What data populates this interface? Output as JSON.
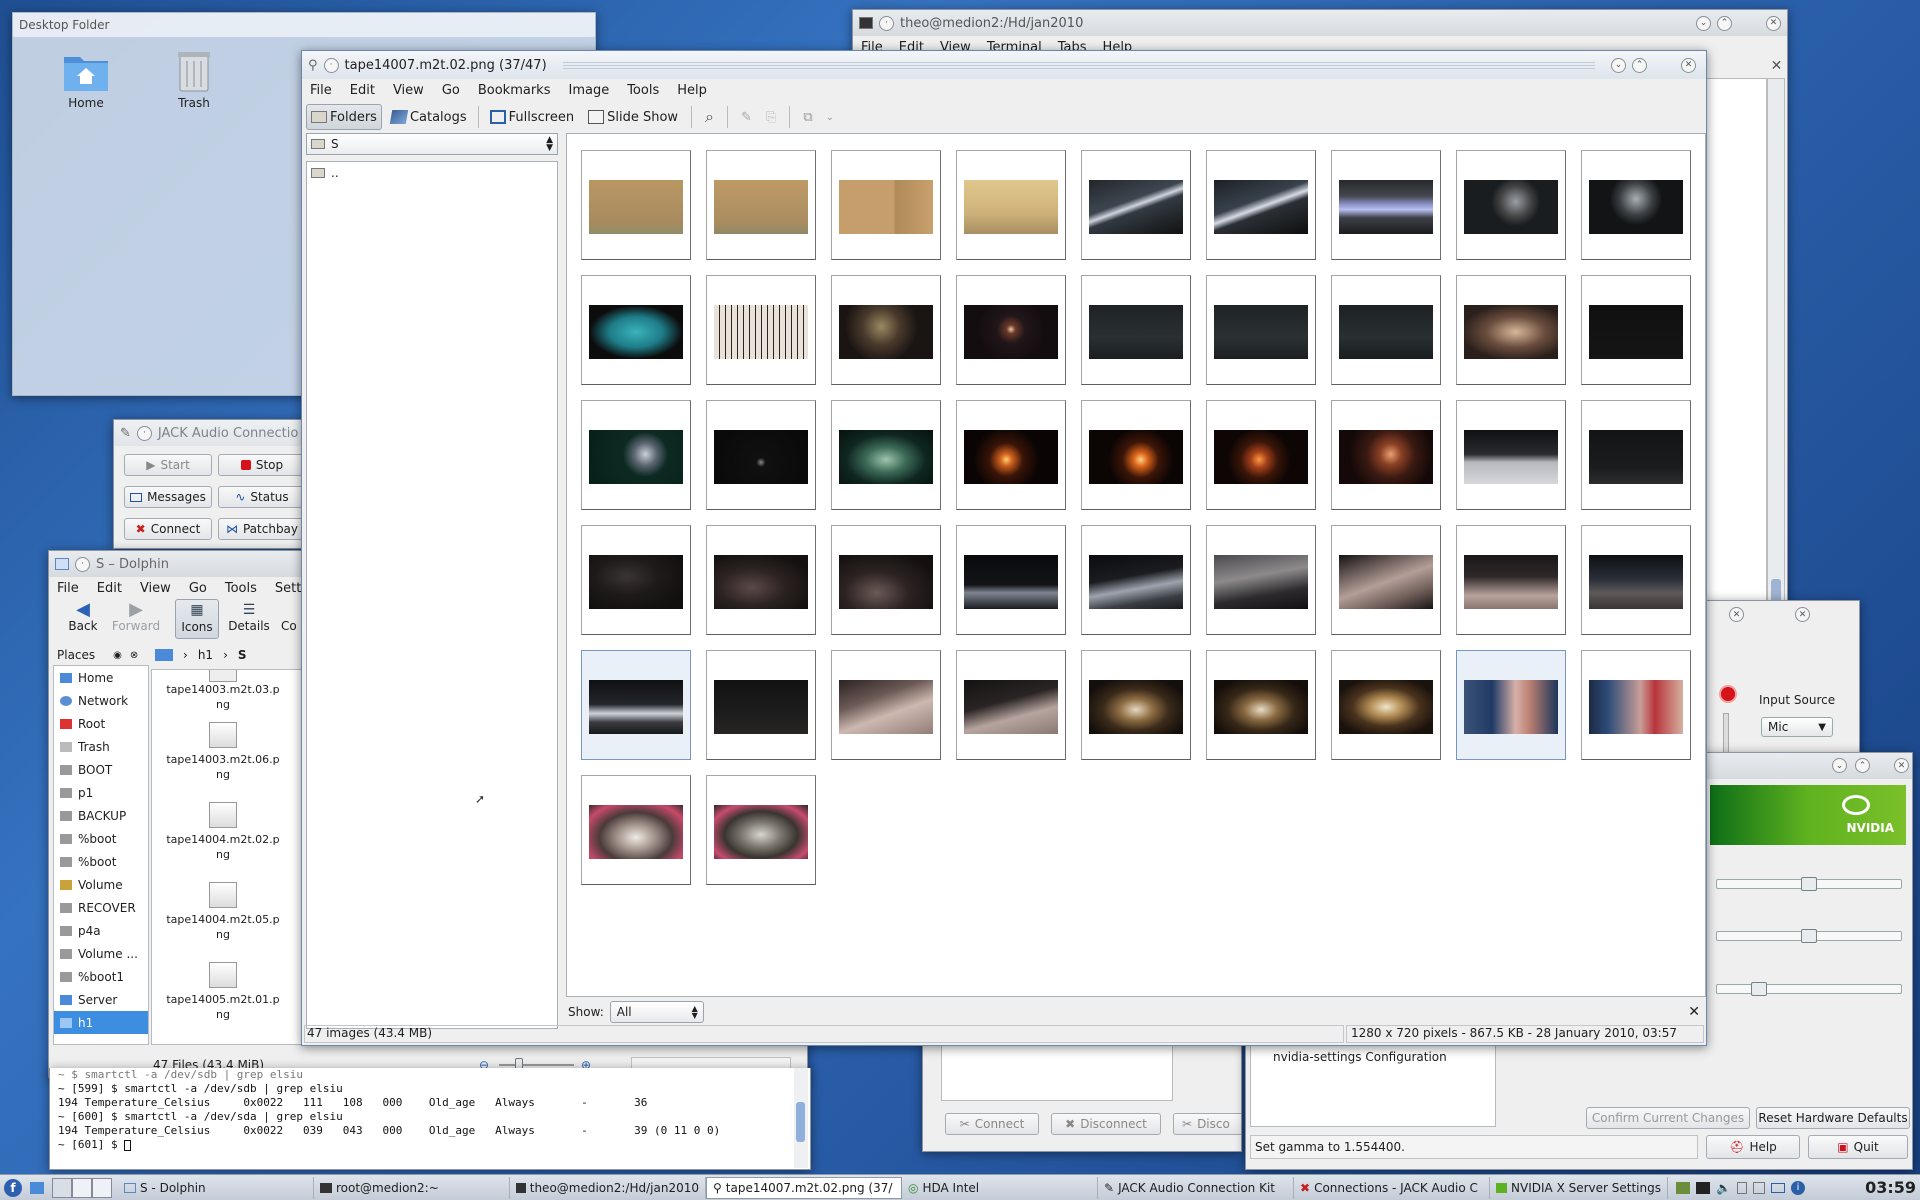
{
  "desktop_folder": {
    "title": "Desktop Folder",
    "icons": [
      {
        "label": "Home"
      },
      {
        "label": "Trash"
      }
    ]
  },
  "terminal_win": {
    "title": "theo@medion2:/Hd/jan2010",
    "menu": [
      "File",
      "Edit",
      "View",
      "Terminal",
      "Tabs",
      "Help"
    ]
  },
  "jack": {
    "title": "JACK Audio Connectio",
    "buttons": {
      "start": "Start",
      "stop": "Stop",
      "messages": "Messages",
      "status": "Status",
      "connect": "Connect",
      "patchbay": "Patchbay"
    }
  },
  "dolphin": {
    "title": "S – Dolphin",
    "menu": [
      "File",
      "Edit",
      "View",
      "Go",
      "Tools",
      "Setting"
    ],
    "toolbar": {
      "back": "Back",
      "forward": "Forward",
      "icons": "Icons",
      "details": "Details",
      "co": "Co"
    },
    "places_title": "Places",
    "places": [
      "Home",
      "Network",
      "Root",
      "Trash",
      "BOOT",
      "p1",
      "BACKUP",
      "%boot",
      "%boot",
      "Volume",
      "RECOVER",
      "p4a",
      "Volume ...",
      "%boot1",
      "Server",
      "h1"
    ],
    "breadcrumb": [
      "h1",
      "S"
    ],
    "files": [
      "tape14003.m2t.03.p\nng",
      "tape14003.m2t.06.p\nng",
      "tape14004.m2t.02.p\nng",
      "tape14004.m2t.05.p\nng",
      "tape14005.m2t.01.p\nng"
    ],
    "status": "47 Files (43.4 MiB)"
  },
  "root_terminal": {
    "lines": [
      "~ $ smartctl -a /dev/sdb | grep elsiu",
      "~ [599] $ smartctl -a /dev/sdb | grep elsiu",
      "194 Temperature_Celsius     0x0022   111   108   000    Old_age   Always       -       36",
      "~ [600] $ smartctl -a /dev/sda | grep elsiu",
      "194 Temperature_Celsius     0x0022   039   043   000    Old_age   Always       -       39 (0 11 0 0)",
      "~ [601] $ "
    ]
  },
  "jack_connections": {
    "buttons": {
      "connect": "Connect",
      "disconnect": "Disconnect",
      "disco": "Disco"
    }
  },
  "hda_mixer": {
    "input_source_label": "Input Source",
    "input_source_value": "Mic"
  },
  "nvidia": {
    "logo": "NVIDIA",
    "config_item": "nvidia-settings Configuration",
    "confirm_btn": "Confirm Current Changes",
    "reset_btn": "Reset Hardware Defaults",
    "status": "Set gamma to 1.554400.",
    "help_btn": "Help",
    "quit_btn": "Quit",
    "slider_values": [
      0.5,
      0.5,
      0.2
    ]
  },
  "gthumb": {
    "title": "tape14007.m2t.02.png  (37/47)",
    "menu": [
      "File",
      "Edit",
      "View",
      "Go",
      "Bookmarks",
      "Image",
      "Tools",
      "Help"
    ],
    "toolbar": {
      "folders": "Folders",
      "catalogs": "Catalogs",
      "fullscreen": "Fullscreen",
      "slideshow": "Slide Show"
    },
    "location": "S",
    "tree_item": "..",
    "show_label": "Show:",
    "show_value": "All",
    "status_left": "47 images (43.4 MB)",
    "status_right": "1280 x 720 pixels - 867.5 KB - 28 January 2010, 03:57",
    "thumbs": [
      {
        "c": "linear-gradient(#b99763,#a78b5f 80%,#8f8d6a)"
      },
      {
        "c": "linear-gradient(#bf9a66,#a98c60 80%,#8d8a68)"
      },
      {
        "c": "linear-gradient(90deg,#c59e6b 0,#c59e6b 58%,#b08a58 60%,#c8a06c 100%)"
      },
      {
        "c": "linear-gradient(#e0c78e,#cfb27a 60%,#a88f63)"
      },
      {
        "c": "linear-gradient(160deg,#23272b 0,#3d4650 40%,#cfd4df 48%,#323a42 55%,#111 100%)"
      },
      {
        "c": "linear-gradient(160deg,#1c2024 0,#38424c 40%,#d7dbe6 50%,#2b3036 58%,#0e0e0e 100%)"
      },
      {
        "c": "linear-gradient(#26282c,#44484e 30%,#8b92c8 45%,#b8bff0 55%,#3d4046 70%,#1b1c1f)"
      },
      {
        "c": "radial-gradient(circle at 55% 40%,#9aa0a8 0,#444 25%,#1a1d20 40%),linear-gradient(90deg,#2db36d,#b23bb2,#0c0c0c)"
      },
      {
        "c": "radial-gradient(circle at 50% 35%,#aab0b6 0,#3a3e42 28%,#121416 45%)"
      },
      {
        "c": "radial-gradient(ellipse at 50% 50%,#3ab4b9 0,#1e7c88 40%,#0c0c0c 70%)"
      },
      {
        "c": "repeating-linear-gradient(90deg,#e8e2d8 0,#e8e2d8 5px,#2a2522 5px,#2a2522 6px)"
      },
      {
        "c": "radial-gradient(circle at 45% 40%,#9a8a62 0,#4a3a2c 30%,#1a1412 60%)"
      },
      {
        "c": "radial-gradient(circle at 50% 45%,#e8c9a0 0,#6b3a2a 8%,#21161a 25%,#140d0f 60%)"
      },
      {
        "c": "linear-gradient(#1e2224,#2a3032 60%,#1a1e20)"
      },
      {
        "c": "linear-gradient(#1f2325,#2b3133 60%,#1b1f21)"
      },
      {
        "c": "linear-gradient(#1d2123,#293032 60%,#191d1f)"
      },
      {
        "c": "radial-gradient(ellipse at 55% 50%,#d8b89a 0,#6a4d3e 40%,#2a1f1a 75%)"
      },
      {
        "c": "linear-gradient(#101010,#151515)"
      },
      {
        "c": "radial-gradient(circle at 60% 45%,#c9cfd6 0,#5a6470 18%,#0d2a22 35%,#062018 100%)"
      },
      {
        "c": "radial-gradient(circle at 50% 60%,#888 0,#101010 8%,#080808 100%)"
      },
      {
        "c": "radial-gradient(ellipse at 50% 55%,#9fc5ac 0,#3c6b58 30%,#0f2620 60%,#07110d 100%)"
      },
      {
        "c": "radial-gradient(circle at 45% 55%,#ffcf6e 0,#d0611e 10%,#3a1408 28%,#0a0504 55%)"
      },
      {
        "c": "radial-gradient(circle at 55% 55%,#ffd080 0,#d8621a 12%,#3d1608 30%,#0b0504 55%)"
      },
      {
        "c": "radial-gradient(circle at 48% 55%,#ff9a40 0,#a4401a 14%,#3a1608 32%,#0e0605 55%)"
      },
      {
        "c": "radial-gradient(circle at 55% 45%,#e9a070 0,#8a4024 18%,#3a1a12 40%,#140908 70%)"
      },
      {
        "c": "linear-gradient(#0f1012 0,#2a2c30 45%,#b7b9be 60%,#d5d7da 100%)"
      },
      {
        "c": "linear-gradient(#121416,#1a1c1e 70%,#2a2c2e)"
      },
      {
        "c": "radial-gradient(ellipse at 40% 40%,#3a3434 0,#1e1a1a 40%,#120f0f 80%)"
      },
      {
        "c": "radial-gradient(ellipse at 40% 60%,#5a4a48 0,#2c2322 40%,#141010 80%)"
      },
      {
        "c": "radial-gradient(ellipse at 40% 70%,#6b5a56 0,#2c2322 40%,#141010 80%)"
      },
      {
        "c": "linear-gradient(#0a0a0c 0,#121418 55%,#7e8590 70%,#1b1c20 100%)"
      },
      {
        "c": "linear-gradient(170deg,#0b0c0e 0,#1a1c20 40%,#9ea4ae 60%,#3a3e44 80%,#1a1b1e 100%)"
      },
      {
        "c": "linear-gradient(170deg,#4a4a4e 0,#8e8a8c 40%,#2c2a2c 70%,#121112 100%)"
      },
      {
        "c": "linear-gradient(160deg,#151213 0,#b59e98 50%,#6e5d58 75%,#1a1516 100%)"
      },
      {
        "c": "linear-gradient(#1a1617 0,#2f2829 40%,#b8a29c 75%,#8a7670 100%)"
      },
      {
        "c": "linear-gradient(#0d0f12 0,#2a2f38 45%,#5e5a5a 70%,#3a3434 100%)"
      },
      {
        "c": "linear-gradient(#0f1013 0,#23262b 45%,#cfd3d9 62%,#3b3d42 78%,#17181a 100%)"
      },
      {
        "c": "linear-gradient(#121212 0,#1d1d1d 60%,#2a2424 100%)"
      },
      {
        "c": "linear-gradient(160deg,#2b2322 0,#6c5a56 35%,#cdb8b0 60%,#927e78 100%)"
      },
      {
        "c": "linear-gradient(165deg,#141212 0,#2a2424 40%,#b6a49e 65%,#8a7872 100%)"
      },
      {
        "c": "radial-gradient(ellipse at 50% 55%,#e6d9c2 0,#8e6d43 25%,#3a2a1a 50%,#150f0b 80%)"
      },
      {
        "c": "radial-gradient(ellipse at 50% 55%,#e8dcc5 0,#8a6a42 25%,#372818 50%,#140e0a 80%)"
      },
      {
        "c": "radial-gradient(ellipse at 50% 50%,#f0e4c8 0,#b08a52 25%,#4a331e 50%,#1a120c 80%)"
      },
      {
        "c": "linear-gradient(90deg,#3b5378 0,#1f3a66 30%,#d7b0a8 55%,#b97f70 70%,#1c355c 100%)"
      },
      {
        "c": "linear-gradient(90deg,#1c2a44 0,#2c4b78 20%,#c89e96 55%,#b8343c 70%,#d5b0a0 100%)"
      },
      {
        "c": "radial-gradient(ellipse at 50% 60%,#f0ece6 0,#9c8e86 30%,#4a3b3a 55%,#c84a6a 80%,#3a2d2e 100%)"
      },
      {
        "c": "radial-gradient(ellipse at 50% 55%,#d8d6d0 0,#7c7670 30%,#3a3430 55%,#c74c70 78%,#2b2623 100%)"
      }
    ],
    "selected": [
      36,
      43
    ]
  },
  "taskbar": {
    "tasks": [
      "S - Dolphin",
      "root@medion2:~",
      "theo@medion2:/Hd/jan2010",
      "tape14007.m2t.02.png (37/",
      "HDA Intel",
      "JACK Audio Connection Kit",
      "Connections - JACK Audio C",
      "NVIDIA X Server Settings"
    ],
    "clock": "03:59"
  }
}
